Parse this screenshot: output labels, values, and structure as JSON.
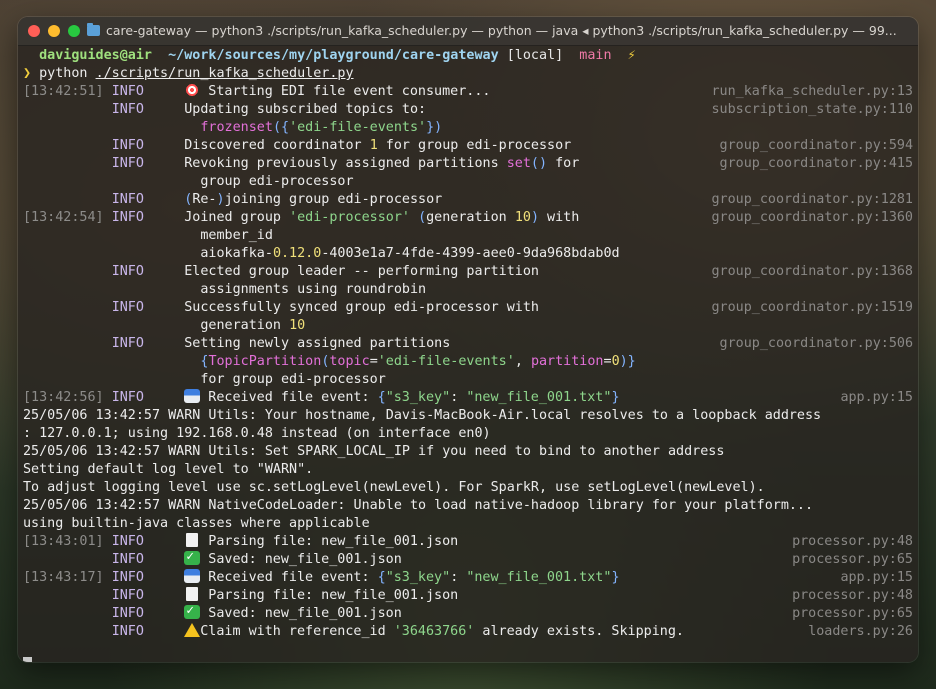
{
  "window": {
    "title": "care-gateway — python3 ./scripts/run_kafka_scheduler.py — python — java ◂ python3 ./scripts/run_kafka_scheduler.py — 99..."
  },
  "prompt": {
    "user_host": "daviguides@air",
    "path": "~/work/sources/my/playground/care-gateway",
    "env": "[local]",
    "branch": "main",
    "bolt_icon": "⚡",
    "symbol": "❯",
    "command_prefix": "python ",
    "command_arg": "./scripts/run_kafka_scheduler.py"
  },
  "log": {
    "l1": {
      "time": "[13:42:51]",
      "level": "INFO",
      "icon": "target-icon",
      "msg": " Starting EDI file event consumer...",
      "src": "run_kafka_scheduler.py:13"
    },
    "l2": {
      "level": "INFO",
      "msg": "Updating subscribed topics to:",
      "src": "subscription_state.py:110"
    },
    "l3": {
      "a": "frozenset",
      "b": "({",
      "c": "'edi-file-events'",
      "d": "})"
    },
    "l4": {
      "level": "INFO",
      "a": "Discovered coordinator ",
      "num": "1",
      "b": " for group edi-processor",
      "src": "group_coordinator.py:594"
    },
    "l5": {
      "level": "INFO",
      "a": "Revoking previously assigned partitions ",
      "kw": "set",
      "paren": "()",
      "b": " for",
      "src": "group_coordinator.py:415"
    },
    "l6": {
      "text": "group edi-processor"
    },
    "l7": {
      "level": "INFO",
      "p1": "(",
      "a": "Re-",
      "p2": ")",
      "b": "joining group edi-processor",
      "src": "group_coordinator.py:1281"
    },
    "l8": {
      "time": "[13:42:54]",
      "level": "INFO",
      "a": "Joined group ",
      "str": "'edi-processor'",
      "b": " ",
      "p1": "(",
      "c": "generation ",
      "num": "10",
      "p2": ")",
      "d": " with",
      "src": "group_coordinator.py:1360"
    },
    "l9": {
      "text": "member_id"
    },
    "l10": {
      "a": "aiokafka-",
      "num": "0.12.0",
      "b": "-4003e1a7-4fde-4399-aee0-9da968bdab0d"
    },
    "l11": {
      "level": "INFO",
      "msg": "Elected group leader -- performing partition",
      "src": "group_coordinator.py:1368"
    },
    "l12": {
      "text": "assignments using roundrobin"
    },
    "l13": {
      "level": "INFO",
      "msg": "Successfully synced group edi-processor with",
      "src": "group_coordinator.py:1519"
    },
    "l14": {
      "a": "generation ",
      "num": "10"
    },
    "l15": {
      "level": "INFO",
      "msg": "Setting newly assigned partitions",
      "src": "group_coordinator.py:506"
    },
    "l16": {
      "a": "{",
      "b": "TopicPartition",
      "c": "(",
      "d": "topic",
      "e": "=",
      "f": "'edi-file-events'",
      "g": ", ",
      "h": "partition",
      "i": "=",
      "j": "0",
      "k": ")}"
    },
    "l17": {
      "text": "for group edi-processor"
    },
    "l18": {
      "time": "[13:42:56]",
      "level": "INFO",
      "icon": "inbox-tray-icon",
      "a": " Received file event: ",
      "b": "{",
      "c": "\"s3_key\"",
      "d": ": ",
      "e": "\"new_file_001.txt\"",
      "f": "}",
      "src": "app.py:15"
    },
    "l19": {
      "text": "25/05/06 13:42:57 WARN Utils: Your hostname, Davis-MacBook-Air.local resolves to a loopback address"
    },
    "l20": {
      "text": ": 127.0.0.1; using 192.168.0.48 instead (on interface en0)"
    },
    "l21": {
      "text": "25/05/06 13:42:57 WARN Utils: Set SPARK_LOCAL_IP if you need to bind to another address"
    },
    "l22": {
      "text": "Setting default log level to \"WARN\"."
    },
    "l23": {
      "text": "To adjust logging level use sc.setLogLevel(newLevel). For SparkR, use setLogLevel(newLevel)."
    },
    "l24": {
      "text": "25/05/06 13:42:57 WARN NativeCodeLoader: Unable to load native-hadoop library for your platform..."
    },
    "l25": {
      "text": "using builtin-java classes where applicable"
    },
    "l26": {
      "time": "[13:43:01]",
      "level": "INFO",
      "icon": "page-icon",
      "msg": " Parsing file: new_file_001.json",
      "src": "processor.py:48"
    },
    "l27": {
      "level": "INFO",
      "icon": "check-mark-icon",
      "msg": " Saved: new_file_001.json",
      "src": "processor.py:65"
    },
    "l28": {
      "time": "[13:43:17]",
      "level": "INFO",
      "icon": "inbox-tray-icon",
      "a": " Received file event: ",
      "b": "{",
      "c": "\"s3_key\"",
      "d": ": ",
      "e": "\"new_file_001.txt\"",
      "f": "}",
      "src": "app.py:15"
    },
    "l29": {
      "level": "INFO",
      "icon": "page-icon",
      "msg": " Parsing file: new_file_001.json",
      "src": "processor.py:48"
    },
    "l30": {
      "level": "INFO",
      "icon": "check-mark-icon",
      "msg": " Saved: new_file_001.json",
      "src": "processor.py:65"
    },
    "l31": {
      "level": "INFO",
      "icon": "warning-icon",
      "a": "Claim with reference_id ",
      "str": "'36463766'",
      "b": " already exists. Skipping.",
      "src": "loaders.py:26"
    }
  },
  "colors": {
    "timestamp": "#8d8c8a",
    "level": "#c9b6ea",
    "string": "#8ed68c",
    "number": "#f0e07a",
    "keyword": "#e270d8",
    "paren": "#83b4ff",
    "source": "#8a8886"
  }
}
